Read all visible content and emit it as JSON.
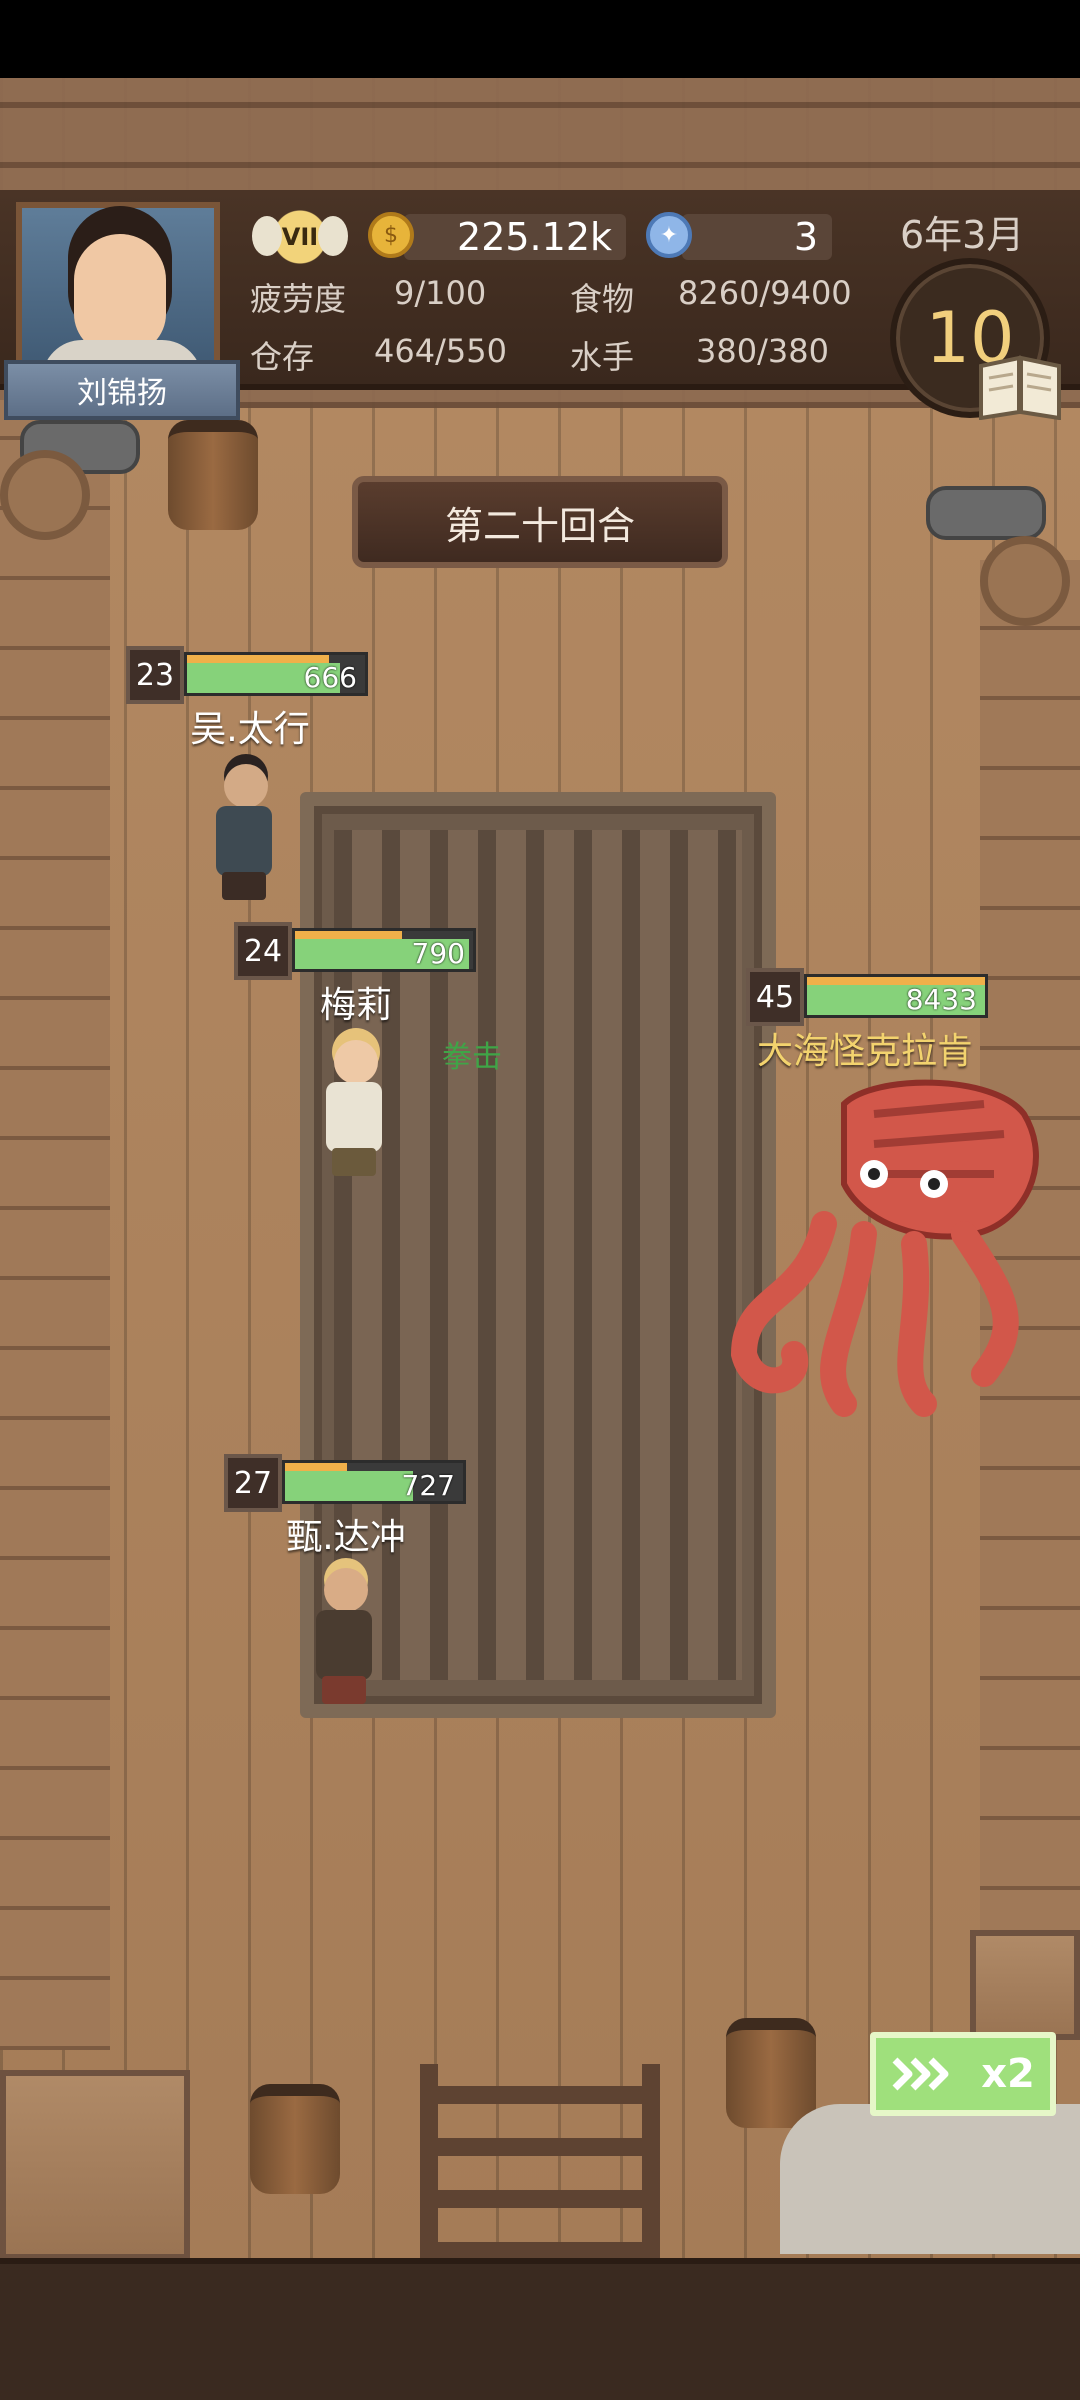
{
  "player": {
    "name": "刘锦扬",
    "rank": "VII"
  },
  "resources": {
    "gold": "225.12k",
    "gems": "3"
  },
  "stats": {
    "fatigue_label": "疲劳度",
    "fatigue_value": "9/100",
    "food_label": "食物",
    "food_value": "8260/9400",
    "storage_label": "仓存",
    "storage_value": "464/550",
    "sailors_label": "水手",
    "sailors_value": "380/380"
  },
  "date": "6年3月",
  "turns_left": "10",
  "round_title": "第二十回合",
  "units": [
    {
      "name": "吴.太行",
      "level": "23",
      "hp": "666",
      "hp_fraction": 0.86
    },
    {
      "name": "梅莉",
      "level": "24",
      "hp": "790",
      "hp_fraction": 0.98
    },
    {
      "name": "甄.达冲",
      "level": "27",
      "hp": "727",
      "hp_fraction": 0.72
    }
  ],
  "enemy": {
    "name": "大海怪克拉肯",
    "level": "45",
    "hp": "8433",
    "hp_fraction": 1.0
  },
  "skill_popup": "拳击",
  "speed_button": {
    "label": "x2"
  },
  "colors": {
    "hp_green": "#86d27a",
    "exp_orange": "#f0b04a",
    "enemy_name": "#f3d36e",
    "skill_green": "#3fa547"
  },
  "icons": [
    "coin-icon",
    "gem-icon",
    "book-icon",
    "fast-forward-icon"
  ]
}
